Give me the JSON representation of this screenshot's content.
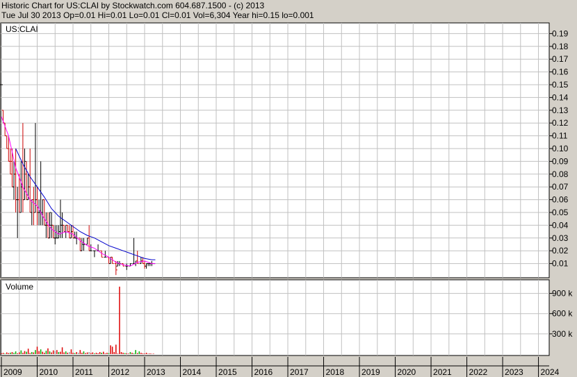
{
  "header": {
    "title": "Historic Chart for US:CLAI by Stockwatch.com 604.687.1500 - (c) 2013",
    "quote": "Tue Jul 30 2013  Op=0.01  Hi=0.01  Lo=0.01  Cl=0.01  Vol=6,304  Year hi=0.15  lo=0.001"
  },
  "colors": {
    "background": "#d4d0c8",
    "plot": "#ffffff",
    "grid": "#c0c0c0",
    "up": "#000000",
    "down": "#cc0000",
    "ma_short": "#ff00ff",
    "ma_long": "#0000cc",
    "volume_up": "#00aa00",
    "volume_down": "#dd0000",
    "volume_flat": "#999999"
  },
  "chart_data": [
    {
      "type": "line",
      "title": "US:CLAI",
      "x_ticks": [
        "2009",
        "2010",
        "2011",
        "2012",
        "2013",
        "2014",
        "2015",
        "2016",
        "2017",
        "2018",
        "2019",
        "2020",
        "2021",
        "2022",
        "2023",
        "2024"
      ],
      "y_ticks": [
        "0.19",
        "0.18",
        "0.17",
        "0.16",
        "0.15",
        "0.14",
        "0.13",
        "0.12",
        "0.11",
        "0.10",
        "0.09",
        "0.08",
        "0.07",
        "0.06",
        "0.05",
        "0.04",
        "0.03",
        "0.02",
        "0.01"
      ],
      "ylim": [
        0,
        0.2
      ],
      "xlim": [
        2009.0,
        2024.3
      ],
      "grid": true,
      "series": [
        {
          "style": "price",
          "points": [
            [
              2009.0,
              0.15,
              0.15,
              0.15,
              0.15
            ],
            [
              2009.05,
              0.13,
              0.13,
              0.12,
              0.12
            ],
            [
              2009.1,
              0.12,
              0.12,
              0.11,
              0.11
            ],
            [
              2009.15,
              0.11,
              0.11,
              0.1,
              0.1
            ],
            [
              2009.2,
              0.1,
              0.11,
              0.09,
              0.09
            ],
            [
              2009.25,
              0.09,
              0.1,
              0.08,
              0.08
            ],
            [
              2009.3,
              0.09,
              0.1,
              0.07,
              0.07
            ],
            [
              2009.35,
              0.07,
              0.09,
              0.06,
              0.08
            ],
            [
              2009.4,
              0.08,
              0.1,
              0.05,
              0.06
            ],
            [
              2009.45,
              0.06,
              0.07,
              0.03,
              0.06
            ],
            [
              2009.5,
              0.06,
              0.08,
              0.05,
              0.05
            ],
            [
              2009.55,
              0.05,
              0.09,
              0.05,
              0.07
            ],
            [
              2009.6,
              0.07,
              0.12,
              0.05,
              0.06
            ],
            [
              2009.65,
              0.06,
              0.1,
              0.06,
              0.09
            ],
            [
              2009.7,
              0.08,
              0.09,
              0.06,
              0.06
            ],
            [
              2009.75,
              0.06,
              0.08,
              0.06,
              0.07
            ],
            [
              2009.8,
              0.07,
              0.1,
              0.05,
              0.05
            ],
            [
              2009.85,
              0.05,
              0.06,
              0.04,
              0.06
            ],
            [
              2009.9,
              0.06,
              0.07,
              0.04,
              0.05
            ],
            [
              2009.95,
              0.05,
              0.12,
              0.05,
              0.06
            ],
            [
              2010.0,
              0.06,
              0.07,
              0.04,
              0.05
            ],
            [
              2010.05,
              0.05,
              0.06,
              0.04,
              0.05
            ],
            [
              2010.1,
              0.05,
              0.09,
              0.04,
              0.05
            ],
            [
              2010.15,
              0.05,
              0.06,
              0.04,
              0.06
            ],
            [
              2010.2,
              0.06,
              0.06,
              0.04,
              0.04
            ],
            [
              2010.25,
              0.04,
              0.05,
              0.03,
              0.04
            ],
            [
              2010.3,
              0.04,
              0.05,
              0.03,
              0.03
            ],
            [
              2010.35,
              0.03,
              0.05,
              0.03,
              0.05
            ],
            [
              2010.4,
              0.04,
              0.05,
              0.03,
              0.04
            ],
            [
              2010.45,
              0.04,
              0.04,
              0.03,
              0.03
            ],
            [
              2010.5,
              0.03,
              0.04,
              0.025,
              0.03
            ],
            [
              2010.55,
              0.03,
              0.04,
              0.03,
              0.03
            ],
            [
              2010.6,
              0.03,
              0.04,
              0.03,
              0.035
            ],
            [
              2010.65,
              0.035,
              0.06,
              0.03,
              0.04
            ],
            [
              2010.7,
              0.04,
              0.05,
              0.03,
              0.04
            ],
            [
              2010.75,
              0.04,
              0.04,
              0.035,
              0.035
            ],
            [
              2010.8,
              0.035,
              0.04,
              0.03,
              0.04
            ],
            [
              2010.85,
              0.04,
              0.04,
              0.035,
              0.035
            ],
            [
              2010.9,
              0.035,
              0.04,
              0.03,
              0.03
            ],
            [
              2010.95,
              0.03,
              0.04,
              0.03,
              0.035
            ],
            [
              2011.0,
              0.035,
              0.04,
              0.03,
              0.03
            ],
            [
              2011.05,
              0.03,
              0.035,
              0.03,
              0.03
            ],
            [
              2011.1,
              0.03,
              0.035,
              0.025,
              0.03
            ],
            [
              2011.2,
              0.03,
              0.03,
              0.02,
              0.02
            ],
            [
              2011.25,
              0.02,
              0.03,
              0.02,
              0.025
            ],
            [
              2011.3,
              0.025,
              0.03,
              0.02,
              0.025
            ],
            [
              2011.4,
              0.025,
              0.03,
              0.025,
              0.03
            ],
            [
              2011.45,
              0.03,
              0.04,
              0.02,
              0.02
            ],
            [
              2011.5,
              0.02,
              0.025,
              0.02,
              0.02
            ],
            [
              2011.6,
              0.02,
              0.02,
              0.015,
              0.02
            ],
            [
              2011.7,
              0.02,
              0.025,
              0.02,
              0.02
            ],
            [
              2011.8,
              0.02,
              0.02,
              0.015,
              0.015
            ],
            [
              2011.9,
              0.015,
              0.02,
              0.015,
              0.015
            ],
            [
              2012.0,
              0.015,
              0.015,
              0.01,
              0.01
            ],
            [
              2012.05,
              0.01,
              0.015,
              0.01,
              0.015
            ],
            [
              2012.1,
              0.015,
              0.015,
              0.01,
              0.01
            ],
            [
              2012.2,
              0.01,
              0.012,
              0.001,
              0.005
            ],
            [
              2012.25,
              0.008,
              0.012,
              0.008,
              0.01
            ],
            [
              2012.3,
              0.01,
              0.012,
              0.008,
              0.01
            ],
            [
              2012.4,
              0.01,
              0.01,
              0.008,
              0.008
            ],
            [
              2012.5,
              0.008,
              0.01,
              0.005,
              0.008
            ],
            [
              2012.6,
              0.008,
              0.01,
              0.008,
              0.01
            ],
            [
              2012.7,
              0.01,
              0.03,
              0.01,
              0.01
            ],
            [
              2012.75,
              0.01,
              0.012,
              0.008,
              0.012
            ],
            [
              2012.8,
              0.012,
              0.02,
              0.01,
              0.01
            ],
            [
              2012.9,
              0.01,
              0.015,
              0.01,
              0.012
            ],
            [
              2012.95,
              0.012,
              0.015,
              0.01,
              0.01
            ],
            [
              2013.0,
              0.01,
              0.012,
              0.006,
              0.008
            ],
            [
              2013.05,
              0.008,
              0.01,
              0.006,
              0.01
            ],
            [
              2013.1,
              0.01,
              0.01,
              0.008,
              0.01
            ],
            [
              2013.15,
              0.01,
              0.01,
              0.008,
              0.01
            ],
            [
              2013.2,
              0.01,
              0.012,
              0.008,
              0.01
            ],
            [
              2013.25,
              0.01,
              0.01,
              0.01,
              0.01
            ]
          ]
        },
        {
          "style": "ma_short",
          "x": [
            2009.0,
            2009.2,
            2009.4,
            2009.6,
            2009.8,
            2010.0,
            2010.2,
            2010.4,
            2010.6,
            2010.8,
            2011.0,
            2011.2,
            2011.4,
            2011.6,
            2011.8,
            2012.0,
            2012.2,
            2012.4,
            2012.6,
            2012.8,
            2013.0,
            2013.2,
            2013.3
          ],
          "values": [
            0.125,
            0.11,
            0.085,
            0.07,
            0.06,
            0.055,
            0.045,
            0.037,
            0.033,
            0.035,
            0.033,
            0.028,
            0.024,
            0.022,
            0.018,
            0.015,
            0.011,
            0.009,
            0.008,
            0.011,
            0.012,
            0.01,
            0.01
          ]
        },
        {
          "style": "ma_long",
          "x": [
            2009.4,
            2009.6,
            2009.8,
            2010.0,
            2010.2,
            2010.4,
            2010.6,
            2010.8,
            2011.0,
            2011.2,
            2011.4,
            2011.6,
            2011.8,
            2012.0,
            2012.2,
            2012.4,
            2012.6,
            2012.8,
            2013.0,
            2013.2,
            2013.3
          ],
          "values": [
            0.1,
            0.088,
            0.078,
            0.07,
            0.062,
            0.053,
            0.047,
            0.043,
            0.039,
            0.035,
            0.032,
            0.03,
            0.027,
            0.024,
            0.022,
            0.02,
            0.018,
            0.016,
            0.014,
            0.013,
            0.013
          ]
        }
      ]
    },
    {
      "type": "bar",
      "title": "Volume",
      "y_ticks": [
        "900 k",
        "600 k",
        "300 k"
      ],
      "ylim": [
        0,
        1050000
      ],
      "bars": [
        [
          2009.0,
          12000,
          "down"
        ],
        [
          2009.05,
          18000,
          "down"
        ],
        [
          2009.1,
          8000,
          "up"
        ],
        [
          2009.15,
          25000,
          "down"
        ],
        [
          2009.2,
          15000,
          "down"
        ],
        [
          2009.25,
          22000,
          "up"
        ],
        [
          2009.3,
          30000,
          "down"
        ],
        [
          2009.35,
          18000,
          "up"
        ],
        [
          2009.4,
          40000,
          "up"
        ],
        [
          2009.45,
          12000,
          "down"
        ],
        [
          2009.5,
          26000,
          "down"
        ],
        [
          2009.55,
          55000,
          "up"
        ],
        [
          2009.6,
          20000,
          "down"
        ],
        [
          2009.65,
          45000,
          "down"
        ],
        [
          2009.7,
          35000,
          "up"
        ],
        [
          2009.75,
          80000,
          "down"
        ],
        [
          2009.8,
          16000,
          "down"
        ],
        [
          2009.85,
          30000,
          "up"
        ],
        [
          2009.9,
          25000,
          "down"
        ],
        [
          2009.95,
          60000,
          "up"
        ],
        [
          2010.0,
          110000,
          "down"
        ],
        [
          2010.05,
          45000,
          "down"
        ],
        [
          2010.1,
          70000,
          "up"
        ],
        [
          2010.15,
          35000,
          "down"
        ],
        [
          2010.2,
          20000,
          "down"
        ],
        [
          2010.25,
          50000,
          "up"
        ],
        [
          2010.3,
          85000,
          "down"
        ],
        [
          2010.35,
          40000,
          "up"
        ],
        [
          2010.4,
          25000,
          "down"
        ],
        [
          2010.45,
          55000,
          "down"
        ],
        [
          2010.5,
          45000,
          "flat"
        ],
        [
          2010.55,
          60000,
          "down"
        ],
        [
          2010.6,
          30000,
          "up"
        ],
        [
          2010.65,
          35000,
          "down"
        ],
        [
          2010.7,
          100000,
          "down"
        ],
        [
          2010.75,
          25000,
          "down"
        ],
        [
          2010.8,
          40000,
          "up"
        ],
        [
          2010.85,
          20000,
          "down"
        ],
        [
          2010.9,
          30000,
          "flat"
        ],
        [
          2010.95,
          70000,
          "down"
        ],
        [
          2011.0,
          20000,
          "down"
        ],
        [
          2011.05,
          15000,
          "up"
        ],
        [
          2011.1,
          30000,
          "down"
        ],
        [
          2011.15,
          20000,
          "flat"
        ],
        [
          2011.2,
          60000,
          "down"
        ],
        [
          2011.25,
          20000,
          "down"
        ],
        [
          2011.3,
          40000,
          "up"
        ],
        [
          2011.35,
          15000,
          "down"
        ],
        [
          2011.4,
          25000,
          "down"
        ],
        [
          2011.45,
          30000,
          "flat"
        ],
        [
          2011.5,
          15000,
          "down"
        ],
        [
          2011.55,
          25000,
          "down"
        ],
        [
          2011.6,
          10000,
          "up"
        ],
        [
          2011.65,
          20000,
          "down"
        ],
        [
          2011.7,
          12000,
          "down"
        ],
        [
          2011.75,
          30000,
          "down"
        ],
        [
          2011.8,
          20000,
          "up"
        ],
        [
          2011.85,
          35000,
          "down"
        ],
        [
          2011.9,
          10000,
          "down"
        ],
        [
          2011.95,
          20000,
          "down"
        ],
        [
          2012.0,
          15000,
          "up"
        ],
        [
          2012.05,
          130000,
          "down"
        ],
        [
          2012.1,
          110000,
          "down"
        ],
        [
          2012.15,
          30000,
          "down"
        ],
        [
          2012.2,
          140000,
          "down"
        ],
        [
          2012.25,
          8000,
          "down"
        ],
        [
          2012.3,
          1000000,
          "down"
        ],
        [
          2012.35,
          30000,
          "down"
        ],
        [
          2012.4,
          20000,
          "down"
        ],
        [
          2012.45,
          15000,
          "up"
        ],
        [
          2012.5,
          12000,
          "down"
        ],
        [
          2012.55,
          8000,
          "down"
        ],
        [
          2012.6,
          30000,
          "up"
        ],
        [
          2012.65,
          20000,
          "down"
        ],
        [
          2012.7,
          10000,
          "up"
        ],
        [
          2012.75,
          60000,
          "up"
        ],
        [
          2012.8,
          15000,
          "down"
        ],
        [
          2012.85,
          40000,
          "up"
        ],
        [
          2012.9,
          20000,
          "down"
        ],
        [
          2012.95,
          10000,
          "down"
        ],
        [
          2013.0,
          8000,
          "down"
        ],
        [
          2013.05,
          20000,
          "down"
        ],
        [
          2013.1,
          6000,
          "down"
        ],
        [
          2013.15,
          10000,
          "down"
        ],
        [
          2013.2,
          5000,
          "down"
        ],
        [
          2013.25,
          6304,
          "down"
        ]
      ]
    }
  ]
}
